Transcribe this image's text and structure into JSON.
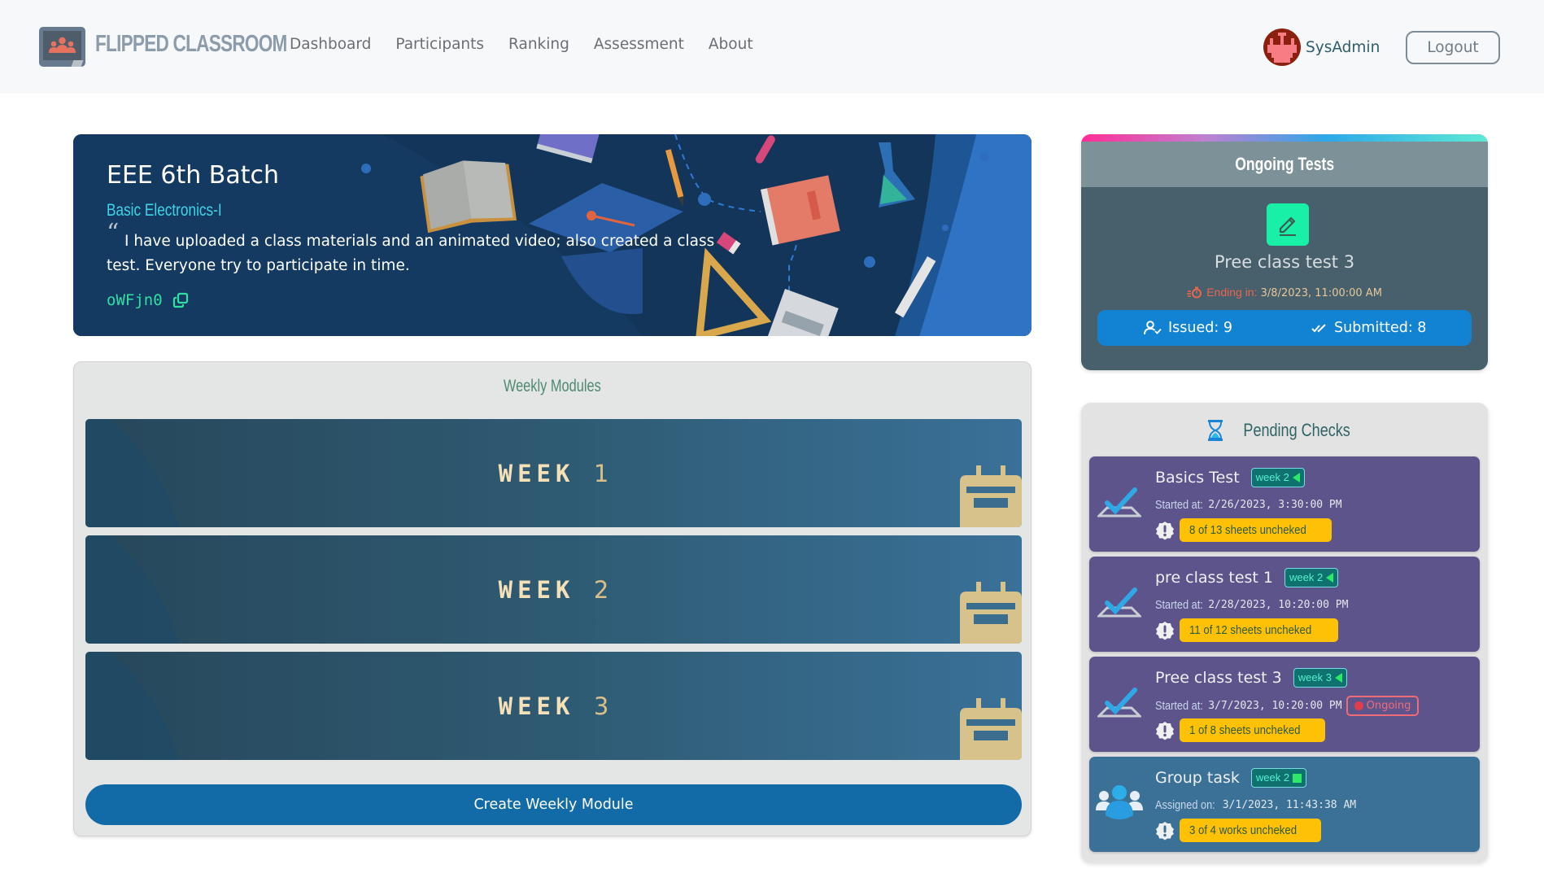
{
  "navbar": {
    "brand": "FLIPPED CLASSROOM",
    "links": [
      "Dashboard",
      "Participants",
      "Ranking",
      "Assessment",
      "About"
    ],
    "username": "SysAdmin",
    "logout_label": "Logout"
  },
  "banner": {
    "title": "EEE 6th Batch",
    "subject": "Basic Electronics-I",
    "message": "I have uploaded a class materials and an animated video; also created a class test. Everyone try to participate in time.",
    "class_code": "oWFjn0"
  },
  "ongoing_tests": {
    "heading": "Ongoing Tests",
    "test_name": "Pree class test 3",
    "ending_label": "Ending in:",
    "ending_value": "3/8/2023, 11:00:00 AM",
    "issued_label": "Issued: 9",
    "submitted_label": "Submitted: 8"
  },
  "pending_checks": {
    "heading": "Pending Checks",
    "items": [
      {
        "name": "Basics Test",
        "week": "week 2",
        "week_marker": "triangle",
        "time_label": "Started at:",
        "time_value": "2/26/2023, 3:30:00 PM",
        "status": "",
        "badge": "8 of 13 sheets uncheked",
        "type": "test"
      },
      {
        "name": "pre class test 1",
        "week": "week 2",
        "week_marker": "triangle",
        "time_label": "Started at:",
        "time_value": "2/28/2023, 10:20:00 PM",
        "status": "",
        "badge": "11 of 12 sheets uncheked",
        "type": "test"
      },
      {
        "name": "Pree class test 3",
        "week": "week 3",
        "week_marker": "triangle",
        "time_label": "Started at:",
        "time_value": "3/7/2023, 10:20:00 PM",
        "status": "Ongoing",
        "badge": "1 of 8 sheets uncheked",
        "type": "test"
      },
      {
        "name": "Group task",
        "week": "week 2",
        "week_marker": "square",
        "time_label": "Assigned on:",
        "time_value": "3/1/2023, 11:43:38 AM",
        "status": "",
        "badge": "3 of 4 works uncheked",
        "type": "group"
      }
    ]
  },
  "weekly_modules": {
    "heading": "Weekly Modules",
    "weeks": [
      {
        "word": "WEEK",
        "number": "1"
      },
      {
        "word": "WEEK",
        "number": "2"
      },
      {
        "word": "WEEK",
        "number": "3"
      }
    ],
    "create_label": "Create Weekly Module"
  },
  "colors": {
    "accent_blue": "#126aa6",
    "code_green": "#2fe0a3",
    "warning_yellow": "#ffc106",
    "pending_purple": "#5d548c",
    "group_blue": "#3b7196"
  }
}
